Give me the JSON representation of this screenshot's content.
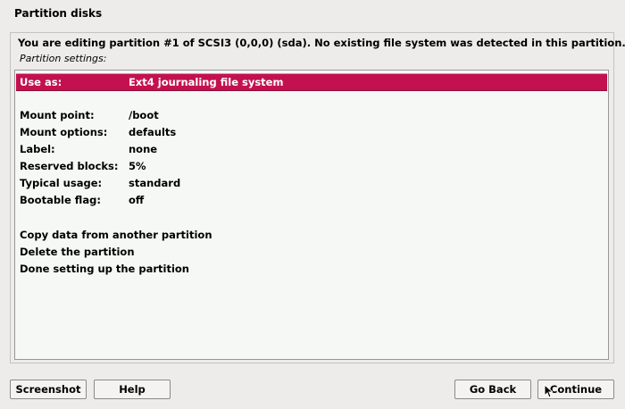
{
  "window": {
    "title": "Partition disks"
  },
  "main": {
    "question": "You are editing partition #1 of SCSI3 (0,0,0) (sda). No existing file system was detected in this partition.",
    "caption": "Partition settings:"
  },
  "list": {
    "use_as": {
      "label": "Use as:",
      "value": "Ext4 journaling file system"
    },
    "settings": [
      {
        "label": "Mount point:",
        "value": "/boot"
      },
      {
        "label": "Mount options:",
        "value": "defaults"
      },
      {
        "label": "Label:",
        "value": "none"
      },
      {
        "label": "Reserved blocks:",
        "value": "5%"
      },
      {
        "label": "Typical usage:",
        "value": "standard"
      },
      {
        "label": "Bootable flag:",
        "value": "off"
      }
    ],
    "actions": [
      "Copy data from another partition",
      "Delete the partition",
      "Done setting up the partition"
    ]
  },
  "buttons": {
    "screenshot": "Screenshot",
    "help": "Help",
    "go_back": "Go Back",
    "continue": "Continue"
  },
  "colors": {
    "selection": "#c3114f",
    "background": "#edeceb",
    "list_background": "#f6f8f5"
  }
}
